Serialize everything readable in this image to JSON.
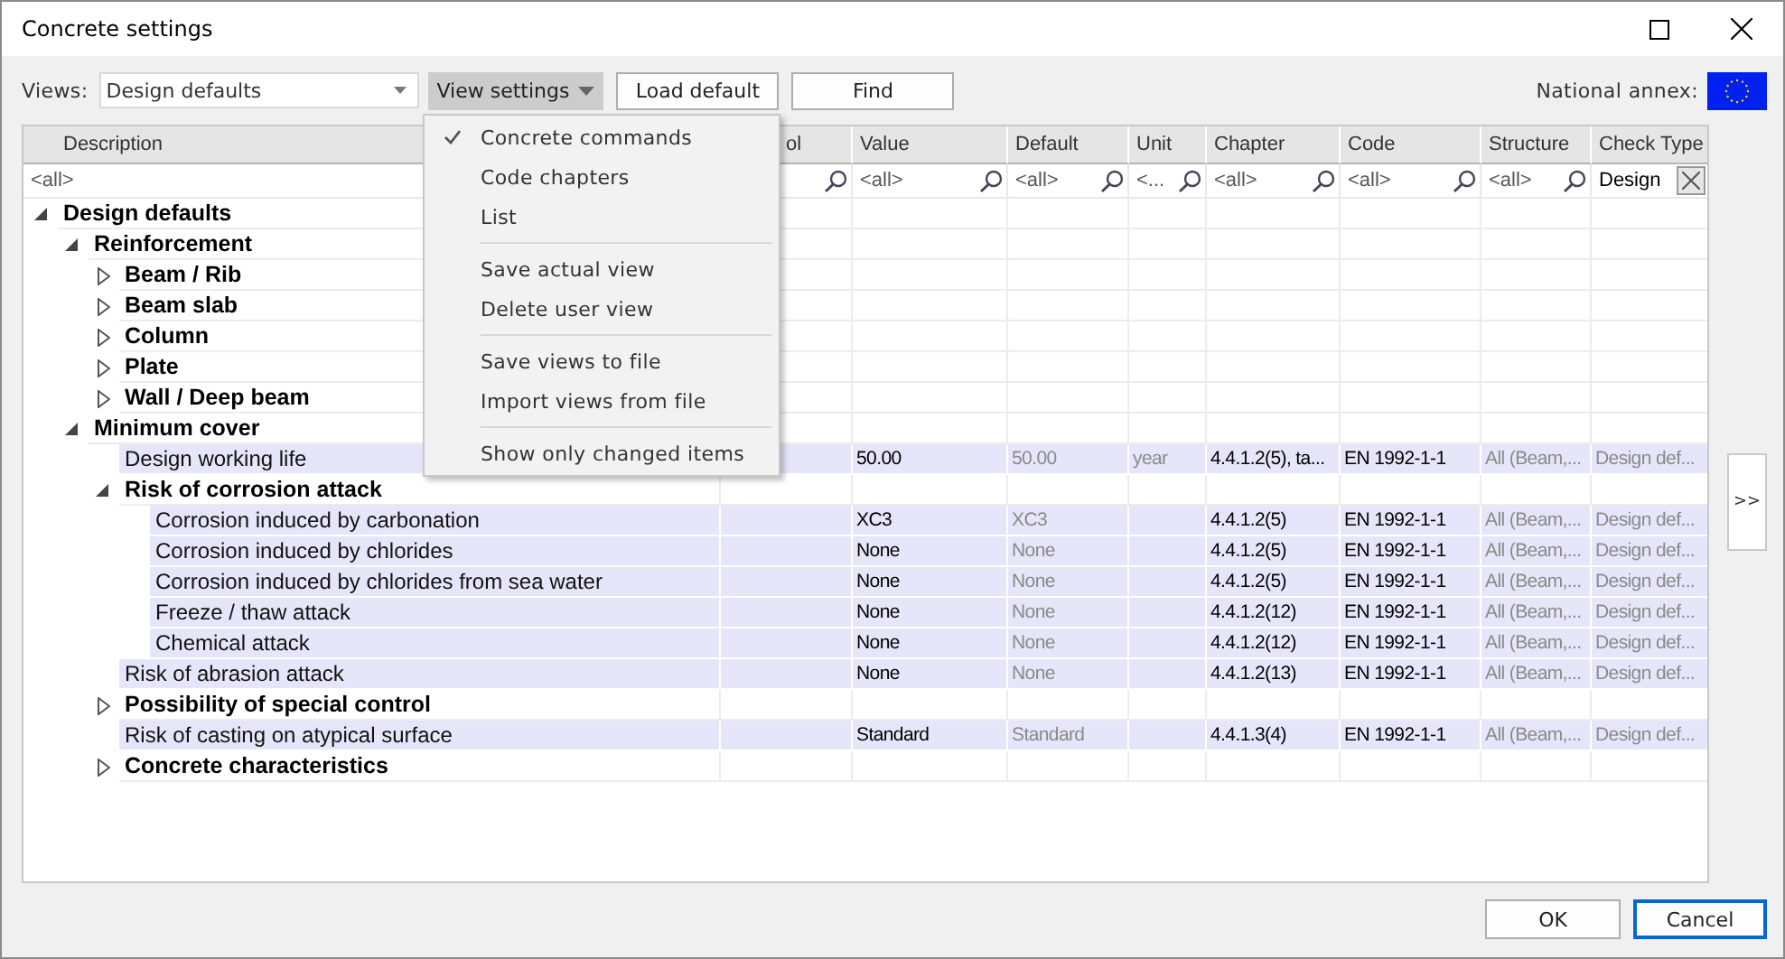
{
  "window": {
    "title": "Concrete settings"
  },
  "toolbar": {
    "views_label": "Views:",
    "views_value": "Design defaults",
    "view_settings": {
      "label": "View settings",
      "open": true
    },
    "buttons": [
      "Load default",
      "Find"
    ],
    "annex_label": "National annex:"
  },
  "menu": {
    "sections": [
      {
        "items": [
          {
            "label": "Concrete commands",
            "checked": true
          },
          {
            "label": "Code chapters",
            "checked": false
          },
          {
            "label": "List",
            "checked": false
          }
        ]
      },
      {
        "items": [
          {
            "label": "Save actual view",
            "checked": false
          },
          {
            "label": "Delete user view",
            "checked": false
          }
        ]
      },
      {
        "items": [
          {
            "label": "Save views to file",
            "checked": false
          },
          {
            "label": "Import views from file",
            "checked": false
          }
        ]
      },
      {
        "items": [
          {
            "label": "Show only changed items",
            "checked": false
          }
        ]
      }
    ]
  },
  "table": {
    "columns": [
      {
        "header": "Description",
        "filter": {
          "placeholder": "<all>"
        }
      },
      {
        "header": "ol",
        "filter": {
          "search_icon": true
        }
      },
      {
        "header": "Value",
        "greyed": false,
        "filter": {
          "placeholder": "<all>",
          "search_icon": true
        }
      },
      {
        "header": "Default",
        "greyed": true,
        "filter": {
          "placeholder": "<all>",
          "search_icon": true
        }
      },
      {
        "header": "Unit",
        "greyed": true,
        "filter": {
          "placeholder": "<...",
          "search_icon": true
        }
      },
      {
        "header": "Chapter",
        "greyed": false,
        "filter": {
          "placeholder": "<all>",
          "search_icon": true
        }
      },
      {
        "header": "Code",
        "greyed": false,
        "filter": {
          "placeholder": "<all>",
          "search_icon": true
        }
      },
      {
        "header": "Structure",
        "greyed": true,
        "filter": {
          "placeholder": "<all>",
          "search_icon": true
        }
      },
      {
        "header": "Check Type",
        "greyed": true,
        "filter": {
          "value": "Design",
          "clear_button": true
        }
      }
    ],
    "rows": [
      {
        "kind": "group",
        "label": "Design defaults",
        "expanded": true,
        "children": [
          {
            "kind": "group",
            "label": "Reinforcement",
            "expanded": true,
            "children": [
              {
                "kind": "group",
                "label": "Beam / Rib",
                "expanded": false
              },
              {
                "kind": "group",
                "label": "Beam slab",
                "expanded": false
              },
              {
                "kind": "group",
                "label": "Column",
                "expanded": false
              },
              {
                "kind": "group",
                "label": "Plate",
                "expanded": false
              },
              {
                "kind": "group",
                "label": "Wall / Deep beam",
                "expanded": false
              }
            ]
          },
          {
            "kind": "group",
            "label": "Minimum cover",
            "expanded": true,
            "children": [
              {
                "kind": "item",
                "label": "Design working life",
                "cells": [
                  null,
                  "50.00",
                  "50.00",
                  "year",
                  "4.4.1.2(5), ta...",
                  "EN 1992-1-1",
                  "All (Beam,...",
                  "Design def..."
                ]
              },
              {
                "kind": "group",
                "label": "Risk of corrosion attack",
                "expanded": true,
                "children": [
                  {
                    "kind": "item",
                    "label": "Corrosion induced by carbonation",
                    "cells": [
                      null,
                      "XC3",
                      "XC3",
                      null,
                      "4.4.1.2(5)",
                      "EN 1992-1-1",
                      "All (Beam,...",
                      "Design def..."
                    ]
                  },
                  {
                    "kind": "item",
                    "label": "Corrosion induced by chlorides",
                    "cells": [
                      null,
                      "None",
                      "None",
                      null,
                      "4.4.1.2(5)",
                      "EN 1992-1-1",
                      "All (Beam,...",
                      "Design def..."
                    ]
                  },
                  {
                    "kind": "item",
                    "label": "Corrosion induced by chlorides from sea water",
                    "cells": [
                      null,
                      "None",
                      "None",
                      null,
                      "4.4.1.2(5)",
                      "EN 1992-1-1",
                      "All (Beam,...",
                      "Design def..."
                    ]
                  },
                  {
                    "kind": "item",
                    "label": "Freeze / thaw attack",
                    "cells": [
                      null,
                      "None",
                      "None",
                      null,
                      "4.4.1.2(12)",
                      "EN 1992-1-1",
                      "All (Beam,...",
                      "Design def..."
                    ]
                  },
                  {
                    "kind": "item",
                    "label": "Chemical attack",
                    "cells": [
                      null,
                      "None",
                      "None",
                      null,
                      "4.4.1.2(12)",
                      "EN 1992-1-1",
                      "All (Beam,...",
                      "Design def..."
                    ]
                  }
                ]
              },
              {
                "kind": "item",
                "label": "Risk of abrasion attack",
                "cells": [
                  null,
                  "None",
                  "None",
                  null,
                  "4.4.1.2(13)",
                  "EN 1992-1-1",
                  "All (Beam,...",
                  "Design def..."
                ]
              },
              {
                "kind": "group",
                "label": "Possibility of special control",
                "expanded": false
              },
              {
                "kind": "item",
                "label": "Risk of casting on atypical surface",
                "cells": [
                  null,
                  "Standard",
                  "Standard",
                  null,
                  "4.4.1.3(4)",
                  "EN 1992-1-1",
                  "All (Beam,...",
                  "Design def..."
                ]
              },
              {
                "kind": "group",
                "label": "Concrete characteristics",
                "expanded": false
              }
            ]
          }
        ]
      }
    ]
  },
  "side_button": ">>",
  "footer": {
    "buttons": [
      {
        "label": "OK",
        "focused": false
      },
      {
        "label": "Cancel",
        "focused": true
      }
    ]
  }
}
